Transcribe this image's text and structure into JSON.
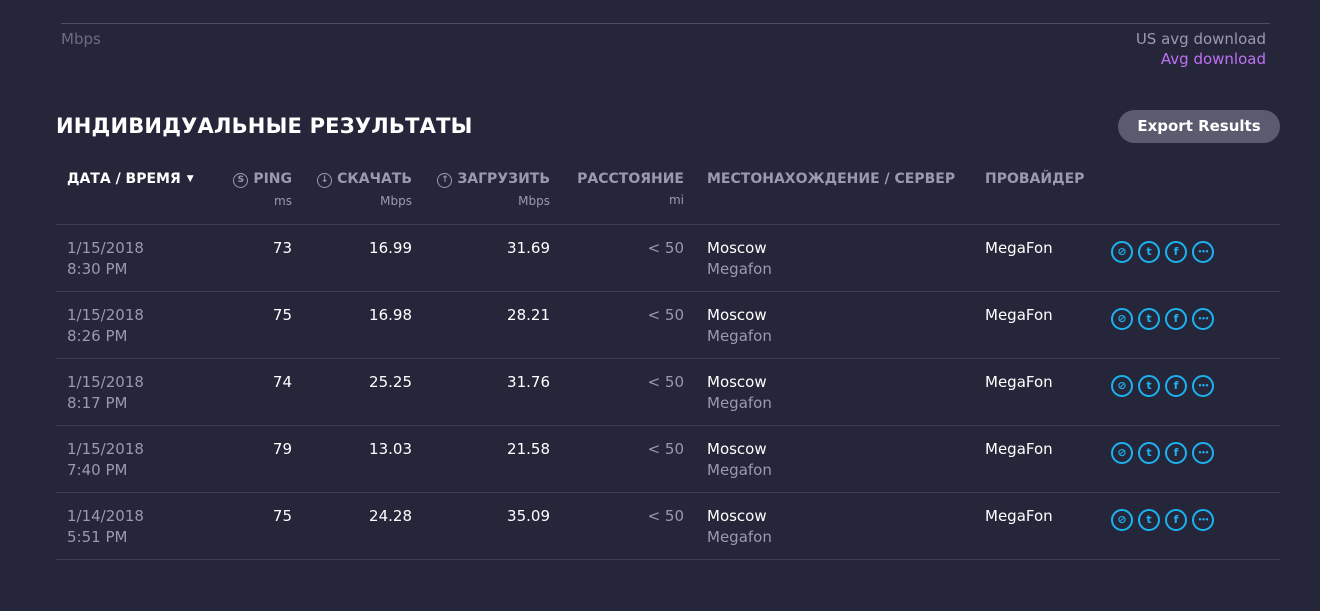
{
  "chart": {
    "y_unit": "Mbps",
    "legend": {
      "us_avg": "US avg download",
      "avg": "Avg download"
    }
  },
  "section": {
    "title": "ИНДИВИДУАЛЬНЫЕ РЕЗУЛЬТАТЫ",
    "export_label": "Export Results"
  },
  "table": {
    "headers": {
      "date": "ДАТА / ВРЕМЯ",
      "ping": "PING",
      "ping_unit": "ms",
      "download": "СКАЧАТЬ",
      "download_unit": "Mbps",
      "upload": "ЗАГРУЗИТЬ",
      "upload_unit": "Mbps",
      "distance": "РАССТОЯНИЕ",
      "distance_unit": "mi",
      "location": "МЕСТОНАХОЖДЕНИЕ / СЕРВЕР",
      "provider": "ПРОВАЙДЕР"
    },
    "rows": [
      {
        "date": "1/15/2018",
        "time": "8:30 PM",
        "ping": "73",
        "download": "16.99",
        "upload": "31.69",
        "distance": "< 50",
        "location": "Moscow",
        "server": "Megafon",
        "provider": "MegaFon"
      },
      {
        "date": "1/15/2018",
        "time": "8:26 PM",
        "ping": "75",
        "download": "16.98",
        "upload": "28.21",
        "distance": "< 50",
        "location": "Moscow",
        "server": "Megafon",
        "provider": "MegaFon"
      },
      {
        "date": "1/15/2018",
        "time": "8:17 PM",
        "ping": "74",
        "download": "25.25",
        "upload": "31.76",
        "distance": "< 50",
        "location": "Moscow",
        "server": "Megafon",
        "provider": "MegaFon"
      },
      {
        "date": "1/15/2018",
        "time": "7:40 PM",
        "ping": "79",
        "download": "13.03",
        "upload": "21.58",
        "distance": "< 50",
        "location": "Moscow",
        "server": "Megafon",
        "provider": "MegaFon"
      },
      {
        "date": "1/14/2018",
        "time": "5:51 PM",
        "ping": "75",
        "download": "24.28",
        "upload": "35.09",
        "distance": "< 50",
        "location": "Moscow",
        "server": "Megafon",
        "provider": "MegaFon"
      }
    ],
    "share_icons": [
      "link-icon",
      "twitter-icon",
      "facebook-icon",
      "more-icon"
    ]
  },
  "colors": {
    "background": "#26263a",
    "accent_purple": "#bf71f3",
    "share_blue": "#1ab3f0",
    "button": "#5b5b6f"
  }
}
